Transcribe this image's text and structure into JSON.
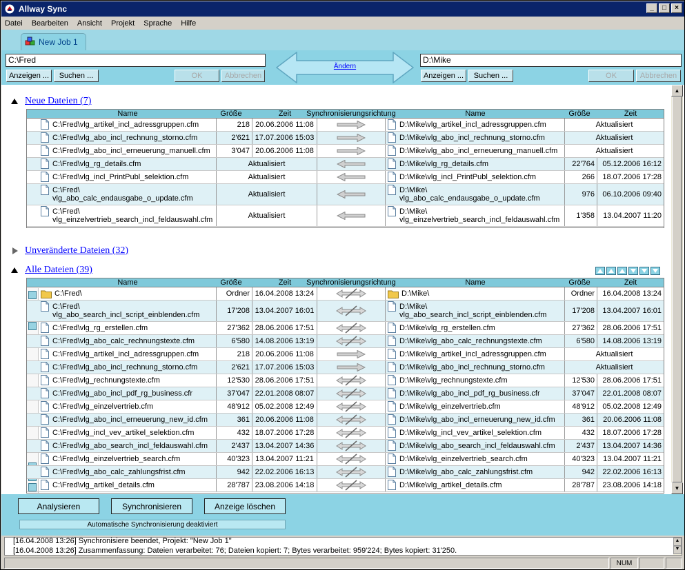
{
  "window": {
    "title": "Allway Sync"
  },
  "menu": [
    "Datei",
    "Bearbeiten",
    "Ansicht",
    "Projekt",
    "Sprache",
    "Hilfe"
  ],
  "tab": {
    "label": "New Job 1"
  },
  "left": {
    "path": "C:\\Fred",
    "show": "Anzeigen ...",
    "search": "Suchen ...",
    "ok": "OK",
    "cancel": "Abbrechen"
  },
  "right": {
    "path": "D:\\Mike",
    "show": "Anzeigen ...",
    "search": "Suchen ...",
    "ok": "OK",
    "cancel": "Abbrechen"
  },
  "swap_label": "Ändern",
  "columns": {
    "name": "Name",
    "size": "Größe",
    "time": "Zeit",
    "dir": "Synchronisierungsrichtung",
    "rname": "Name",
    "rsize": "Größe",
    "rtime": "Zeit"
  },
  "sections": {
    "new_title": "Neue Dateien (7)",
    "unchanged_title": "Unveränderte Dateien (32)",
    "all_title": "Alle Dateien (39)"
  },
  "new_rows": [
    {
      "l": "C:\\Fred\\vlg_artikel_incl_adressgruppen.cfm",
      "ls": "218",
      "lt": "20.06.2006 11:08",
      "dir": "right",
      "r": "D:\\Mike\\vlg_artikel_incl_adressgruppen.cfm",
      "rs": "",
      "rt": "Aktualisiert"
    },
    {
      "l": "C:\\Fred\\vlg_abo_incl_rechnung_storno.cfm",
      "ls": "2'621",
      "lt": "17.07.2006 15:03",
      "dir": "right",
      "r": "D:\\Mike\\vlg_abo_incl_rechnung_storno.cfm",
      "rs": "",
      "rt": "Aktualisiert"
    },
    {
      "l": "C:\\Fred\\vlg_abo_incl_erneuerung_manuell.cfm",
      "ls": "3'047",
      "lt": "20.06.2006 11:08",
      "dir": "right",
      "r": "D:\\Mike\\vlg_abo_incl_erneuerung_manuell.cfm",
      "rs": "",
      "rt": "Aktualisiert"
    },
    {
      "l": "C:\\Fred\\vlg_rg_details.cfm",
      "ls": "",
      "lt": "Aktualisiert",
      "dir": "left",
      "r": "D:\\Mike\\vlg_rg_details.cfm",
      "rs": "22'764",
      "rt": "05.12.2006 16:12"
    },
    {
      "l": "C:\\Fred\\vlg_incl_PrintPubl_selektion.cfm",
      "ls": "",
      "lt": "Aktualisiert",
      "dir": "left",
      "r": "D:\\Mike\\vlg_incl_PrintPubl_selektion.cfm",
      "rs": "266",
      "rt": "18.07.2006 17:28"
    },
    {
      "l": "C:\\Fred\\",
      "l2": "vlg_abo_calc_endausgabe_o_update.cfm",
      "ls": "",
      "lt": "Aktualisiert",
      "dir": "left",
      "r": "D:\\Mike\\",
      "r2": "vlg_abo_calc_endausgabe_o_update.cfm",
      "rs": "976",
      "rt": "06.10.2006 09:40"
    },
    {
      "l": "C:\\Fred\\",
      "l2": "vlg_einzelvertrieb_search_incl_feldauswahl.cfm",
      "ls": "",
      "lt": "Aktualisiert",
      "dir": "left",
      "r": "D:\\Mike\\",
      "r2": "vlg_einzelvertrieb_search_incl_feldauswahl.cfm",
      "rs": "1'358",
      "rt": "13.04.2007 11:20"
    }
  ],
  "all_rows": [
    {
      "l": "C:\\Fred\\",
      "folder": true,
      "ls": "Ordner",
      "lt": "16.04.2008 13:24",
      "dir": "none",
      "r": "D:\\Mike\\",
      "rs": "Ordner",
      "rt": "16.04.2008 13:24"
    },
    {
      "l": "C:\\Fred\\",
      "l2": "vlg_abo_search_incl_script_einblenden.cfm",
      "ls": "17'208",
      "lt": "13.04.2007 16:01",
      "dir": "none",
      "r": "D:\\Mike\\",
      "r2": "vlg_abo_search_incl_script_einblenden.cfm",
      "rs": "17'208",
      "rt": "13.04.2007 16:01"
    },
    {
      "l": "C:\\Fred\\vlg_rg_erstellen.cfm",
      "ls": "27'362",
      "lt": "28.06.2006 17:51",
      "dir": "none",
      "r": "D:\\Mike\\vlg_rg_erstellen.cfm",
      "rs": "27'362",
      "rt": "28.06.2006 17:51"
    },
    {
      "l": "C:\\Fred\\vlg_abo_calc_rechnungstexte.cfm",
      "ls": "6'580",
      "lt": "14.08.2006 13:19",
      "dir": "none",
      "r": "D:\\Mike\\vlg_abo_calc_rechnungstexte.cfm",
      "rs": "6'580",
      "rt": "14.08.2006 13:19"
    },
    {
      "l": "C:\\Fred\\vlg_artikel_incl_adressgruppen.cfm",
      "ls": "218",
      "lt": "20.06.2006 11:08",
      "dir": "right",
      "r": "D:\\Mike\\vlg_artikel_incl_adressgruppen.cfm",
      "rs": "",
      "rt": "Aktualisiert"
    },
    {
      "l": "C:\\Fred\\vlg_abo_incl_rechnung_storno.cfm",
      "ls": "2'621",
      "lt": "17.07.2006 15:03",
      "dir": "right",
      "r": "D:\\Mike\\vlg_abo_incl_rechnung_storno.cfm",
      "rs": "",
      "rt": "Aktualisiert"
    },
    {
      "l": "C:\\Fred\\vlg_rechnungstexte.cfm",
      "ls": "12'530",
      "lt": "28.06.2006 17:51",
      "dir": "none",
      "r": "D:\\Mike\\vlg_rechnungstexte.cfm",
      "rs": "12'530",
      "rt": "28.06.2006 17:51"
    },
    {
      "l": "C:\\Fred\\vlg_abo_incl_pdf_rg_business.cfr",
      "ls": "37'047",
      "lt": "22.01.2008 08:07",
      "dir": "none",
      "r": "D:\\Mike\\vlg_abo_incl_pdf_rg_business.cfr",
      "rs": "37'047",
      "rt": "22.01.2008 08:07"
    },
    {
      "l": "C:\\Fred\\vlg_einzelvertrieb.cfm",
      "ls": "48'912",
      "lt": "05.02.2008 12:49",
      "dir": "none",
      "r": "D:\\Mike\\vlg_einzelvertrieb.cfm",
      "rs": "48'912",
      "rt": "05.02.2008 12:49"
    },
    {
      "l": "C:\\Fred\\vlg_abo_incl_erneuerung_new_id.cfm",
      "ls": "361",
      "lt": "20.06.2006 11:08",
      "dir": "none",
      "r": "D:\\Mike\\vlg_abo_incl_erneuerung_new_id.cfm",
      "rs": "361",
      "rt": "20.06.2006 11:08"
    },
    {
      "l": "C:\\Fred\\vlg_incl_vev_artikel_selektion.cfm",
      "ls": "432",
      "lt": "18.07.2006 17:28",
      "dir": "none",
      "r": "D:\\Mike\\vlg_incl_vev_artikel_selektion.cfm",
      "rs": "432",
      "rt": "18.07.2006 17:28"
    },
    {
      "l": "C:\\Fred\\vlg_abo_search_incl_feldauswahl.cfm",
      "ls": "2'437",
      "lt": "13.04.2007 14:36",
      "dir": "none",
      "r": "D:\\Mike\\vlg_abo_search_incl_feldauswahl.cfm",
      "rs": "2'437",
      "rt": "13.04.2007 14:36"
    },
    {
      "l": "C:\\Fred\\vlg_einzelvertrieb_search.cfm",
      "ls": "40'323",
      "lt": "13.04.2007 11:21",
      "dir": "none",
      "r": "D:\\Mike\\vlg_einzelvertrieb_search.cfm",
      "rs": "40'323",
      "rt": "13.04.2007 11:21"
    },
    {
      "l": "C:\\Fred\\vlg_abo_calc_zahlungsfrist.cfm",
      "ls": "942",
      "lt": "22.02.2006 16:13",
      "dir": "none",
      "r": "D:\\Mike\\vlg_abo_calc_zahlungsfrist.cfm",
      "rs": "942",
      "rt": "22.02.2006 16:13"
    },
    {
      "l": "C:\\Fred\\vlg_artikel_details.cfm",
      "ls": "28'787",
      "lt": "23.08.2006 14:18",
      "dir": "none",
      "r": "D:\\Mike\\vlg_artikel_details.cfm",
      "rs": "28'787",
      "rt": "23.08.2006 14:18"
    }
  ],
  "actions": {
    "analyze": "Analysieren",
    "sync": "Synchronisieren",
    "clear": "Anzeige löschen",
    "autosync": "Automatische Synchronisierung deaktiviert"
  },
  "log": [
    "[16.04.2008 13:26] Synchronisiere beendet, Projekt: \"New Job 1\"",
    "[16.04.2008 13:26] Zusammenfassung: Dateien verarbeitet: 76; Dateien kopiert: 7; Bytes verarbeitet: 959'224; Bytes kopiert: 31'250."
  ],
  "status": {
    "num": "NUM"
  },
  "colors": {
    "accent": "#8cd3e4",
    "header": "#7fc9da",
    "alt_row": "#dff1f6",
    "link": "#0000ff",
    "titlebar": "#0a246a"
  },
  "icons": {
    "app": "allway-sync-logo",
    "tab": "cubes-icon",
    "file": "file-icon",
    "folder": "folder-icon",
    "arrow": "sync-direction-arrow"
  }
}
